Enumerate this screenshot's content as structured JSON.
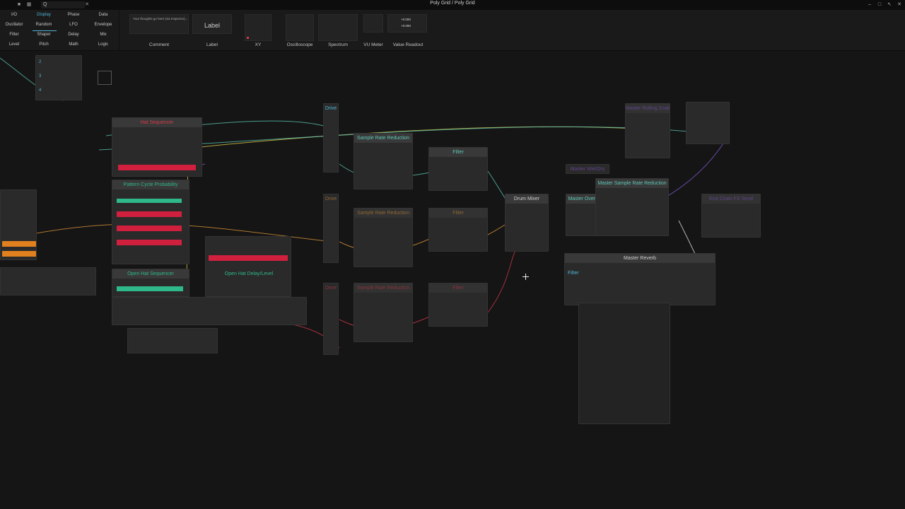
{
  "window": {
    "title": "Poly Grid / Poly Grid",
    "search_value": "Q"
  },
  "palette": {
    "categories": [
      {
        "label": "I/O",
        "active": false
      },
      {
        "label": "Display",
        "active": true
      },
      {
        "label": "Phase",
        "active": false
      },
      {
        "label": "Data",
        "active": false
      },
      {
        "label": "Oscillator",
        "active": false
      },
      {
        "label": "Random",
        "active": false
      },
      {
        "label": "LFO",
        "active": false
      },
      {
        "label": "Envelope",
        "active": false
      },
      {
        "label": "Filter",
        "active": false
      },
      {
        "label": "Shaper",
        "active": false
      },
      {
        "label": "Delay",
        "active": false
      },
      {
        "label": "Mix",
        "active": false
      },
      {
        "label": "Level",
        "active": false
      },
      {
        "label": "Pitch",
        "active": false
      },
      {
        "label": "Math",
        "active": false
      },
      {
        "label": "Logic",
        "active": false
      }
    ],
    "tiles": {
      "comment_text": "Your thoughts go here (via Inspector)...",
      "label_text": "Label",
      "readout_a": "+0.000",
      "readout_b": "+0.000",
      "labels": [
        "Comment",
        "Label",
        "XY",
        "Oscilloscope",
        "Spectrum",
        "VU Meter",
        "Value Readout"
      ]
    }
  },
  "voice_list": [
    "2",
    "3",
    "4"
  ],
  "modules": {
    "hat_sequencer": "Hat Sequencer",
    "pattern_cycle_probability": "Pattern Cycle Probability",
    "open_hat_sequencer": "Open Hat Sequencer",
    "open_hat_delay_level": "Open Hat Delay/Level",
    "drive_1": "Drive",
    "drive_2": "Drive",
    "drive_3": "Drive",
    "sample_rate_reduction_1": "Sample Rate Reduction",
    "sample_rate_reduction_2": "Sample Rate Reduction",
    "sample_rate_reduction_3": "Sample Rate Reduction",
    "filter_1": "Filter",
    "filter_2": "Filter",
    "filter_3": "Filter",
    "drum_mixer": "Drum Mixer",
    "master_wet_dry": "Master Wet/Dry",
    "master_overdrive": "Master OverDrive",
    "master_sample_rate_reduction": "Master Sample Rate Reduction",
    "master_rolling_scale": "Master Rolling Scale",
    "end_chain_fx_send": "End Chain FX Send",
    "master_reverb": "Master Reverb",
    "master_reverb_filter": "Filter"
  },
  "colors": {
    "accent": "#4fb6d8",
    "wire_yellow": "#e9d64a",
    "wire_teal": "#5ec8b8",
    "wire_orange": "#e09a3a",
    "wire_red": "#d23a4c",
    "wire_purple": "#8a5bd6",
    "wire_white": "#e6e6e6",
    "step_red": "#d0203e",
    "step_green": "#2fb88a",
    "step_orange": "#e0801e"
  }
}
